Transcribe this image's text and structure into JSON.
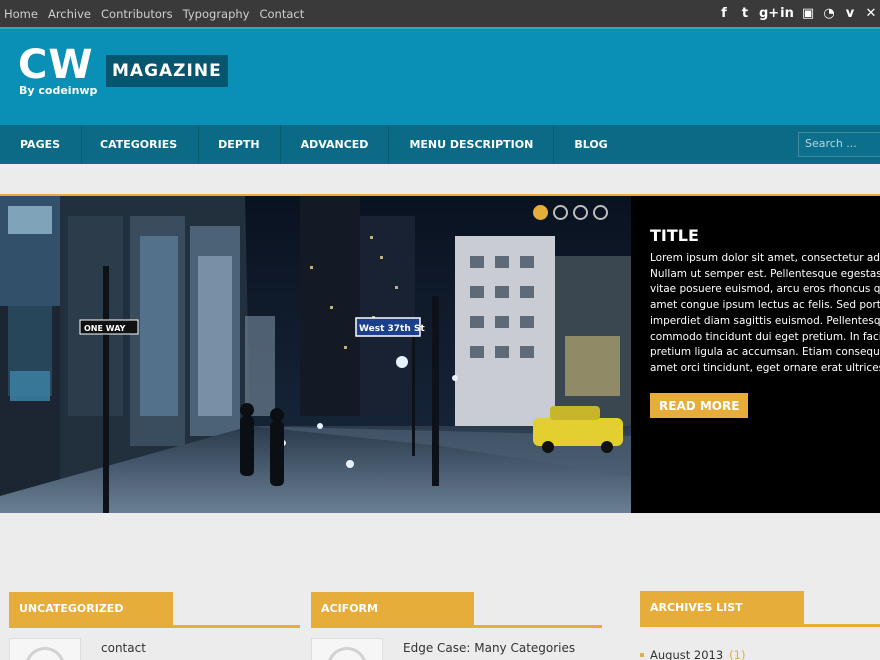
{
  "topnav": [
    "Home",
    "Archive",
    "Contributors",
    "Typography",
    "Contact"
  ],
  "social_icons": [
    {
      "name": "facebook-icon",
      "glyph": "f"
    },
    {
      "name": "twitter-icon",
      "glyph": "t"
    },
    {
      "name": "googleplus-icon",
      "glyph": "g+"
    },
    {
      "name": "linkedin-icon",
      "glyph": "in"
    },
    {
      "name": "youtube-icon",
      "glyph": "▣"
    },
    {
      "name": "rss-icon",
      "glyph": "◔"
    },
    {
      "name": "vimeo-icon",
      "glyph": "v"
    },
    {
      "name": "more-icon",
      "glyph": "✕"
    }
  ],
  "header": {
    "logo_main": "CW",
    "logo_sub": "By codeinwp",
    "logo_tag": "MAGAZINE"
  },
  "nav": {
    "items": [
      "PAGES",
      "CATEGORIES",
      "DEPTH",
      "ADVANCED",
      "MENU DESCRIPTION",
      "BLOG"
    ],
    "search_placeholder": "Search ..."
  },
  "slider": {
    "title": "TITLE",
    "text_lines": [
      "Lorem ipsum dolor sit amet, consectetur ad",
      "Nullam ut semper est. Pellentesque egestas",
      "vitae posuere euismod, arcu eros rhoncus q",
      "amet congue ipsum lectus ac felis. Sed port",
      "imperdiet diam sagittis euismod. Pellentesq",
      "commodo tincidunt dui eget pretium. In faci",
      "pretium ligula ac accumsan. Etiam consequa",
      "amet orci tincidunt, eget ornare erat ultrices"
    ],
    "read_more": "READ MORE",
    "street_sign": "West 37th St",
    "one_way_sign": "ONE WAY",
    "slide_count": 4,
    "active_slide": 1
  },
  "widgets": [
    {
      "title": "UNCATEGORIZED",
      "link": "contact"
    },
    {
      "title": "ACIFORM",
      "link": "Edge Case: Many Categories"
    },
    {
      "title": "ARCHIVES LIST",
      "archive_month": "August 2013",
      "archive_count": "(1)"
    }
  ],
  "colors": {
    "accent": "#e7ad3b",
    "header_blue": "#0a90b7",
    "nav_blue": "#0b6a85",
    "topbar": "#3a3a3a"
  }
}
